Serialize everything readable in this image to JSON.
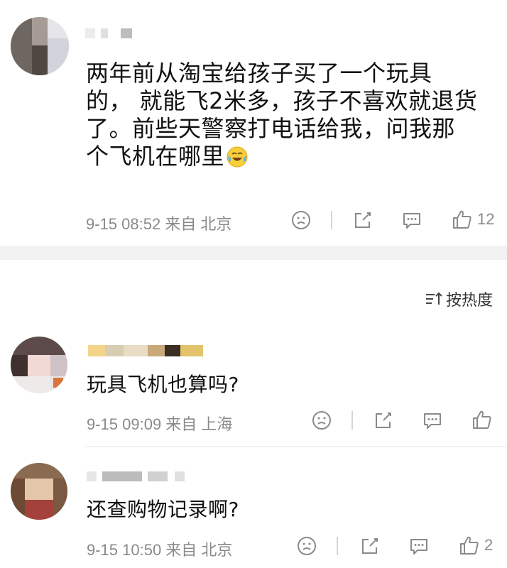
{
  "post": {
    "text": "两年前从淘宝给孩子买了一个玩具的， 就能飞2米多，孩子不喜欢就退货了。前些天警察打电话给我，问我那个飞机在哪里",
    "lines": [
      "两年前从淘宝给孩子买了一个玩具",
      "的， 就能飞2米多，孩子不喜欢就退货",
      "了。前些天警察打电话给我，问我那",
      "个飞机在哪里"
    ],
    "emoji": "laugh-cry-emoji",
    "meta": "9-15 08:52 来自 北京",
    "like_count": "12"
  },
  "sort": {
    "label": "按热度"
  },
  "comments": [
    {
      "text": "玩具飞机也算吗?",
      "meta": "9-15 09:09 来自 上海",
      "like_count": ""
    },
    {
      "text": "还查购物记录啊?",
      "meta": "9-15 10:50 来自 北京",
      "like_count": "2"
    }
  ]
}
